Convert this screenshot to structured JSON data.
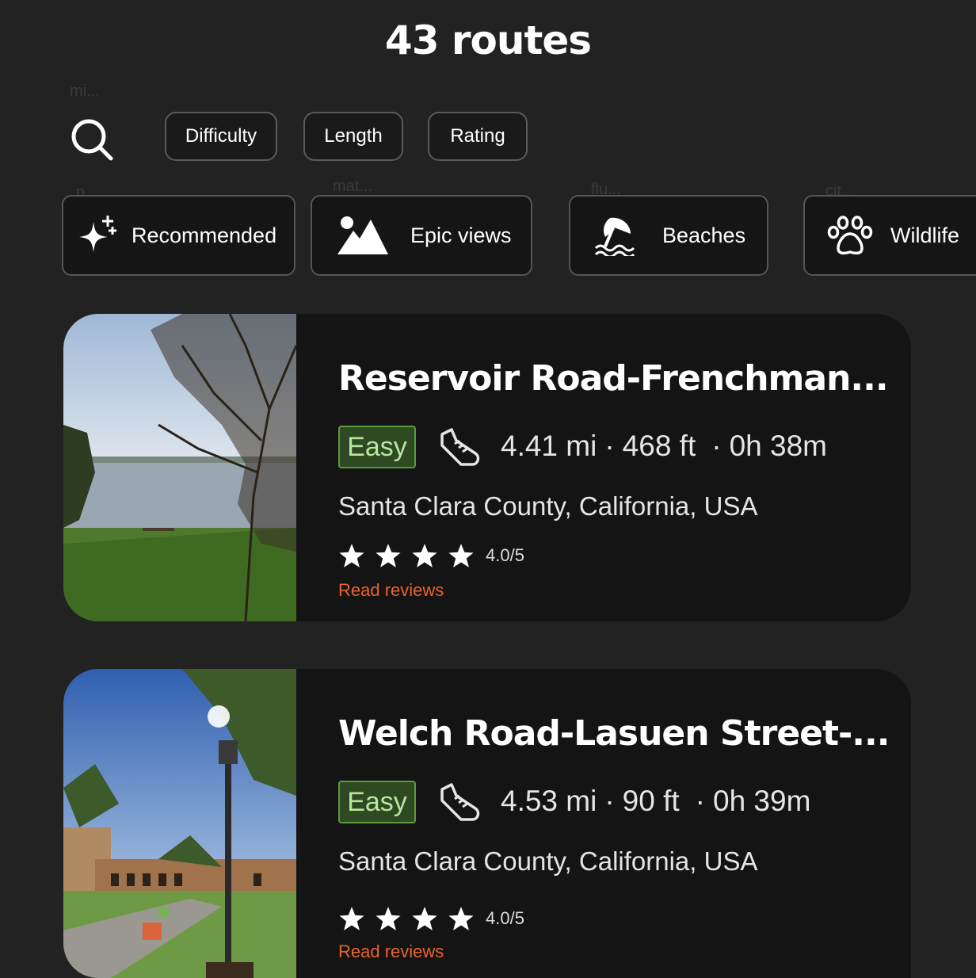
{
  "header": {
    "title": "43 routes"
  },
  "ghost_text": [
    "mi...",
    "p...",
    "mat...",
    "flu...",
    "cit..."
  ],
  "filters": [
    {
      "label": "Difficulty"
    },
    {
      "label": "Length"
    },
    {
      "label": "Rating"
    }
  ],
  "categories": [
    {
      "label": "Recommended",
      "icon": "sparkle-icon"
    },
    {
      "label": "Epic views",
      "icon": "mountain-icon"
    },
    {
      "label": "Beaches",
      "icon": "beach-umbrella-icon"
    },
    {
      "label": "Wildlife",
      "icon": "paw-icon"
    }
  ],
  "routes": [
    {
      "name": "Reservoir Road-Frenchman...",
      "difficulty": "Easy",
      "distance": "4.41 mi",
      "elevation": "468 ft",
      "duration": "0h 38m",
      "location": "Santa Clara County, California, USA",
      "stars": 4,
      "rating": "4.0/5",
      "reviews_label": "Read reviews",
      "photo": "lake-with-oak-tree"
    },
    {
      "name": "Welch Road-Lasuen Street-...",
      "difficulty": "Easy",
      "distance": "4.53 mi",
      "elevation": "90 ft",
      "duration": "0h 39m",
      "location": "Santa Clara County, California, USA",
      "stars": 4,
      "rating": "4.0/5",
      "reviews_label": "Read reviews",
      "photo": "palm-trees-courtyard"
    }
  ],
  "colors": {
    "background": "#222222",
    "card": "#141414",
    "badge_bg": "#2f4a22",
    "badge_text": "#b8e7a0",
    "link": "#e8642d"
  }
}
